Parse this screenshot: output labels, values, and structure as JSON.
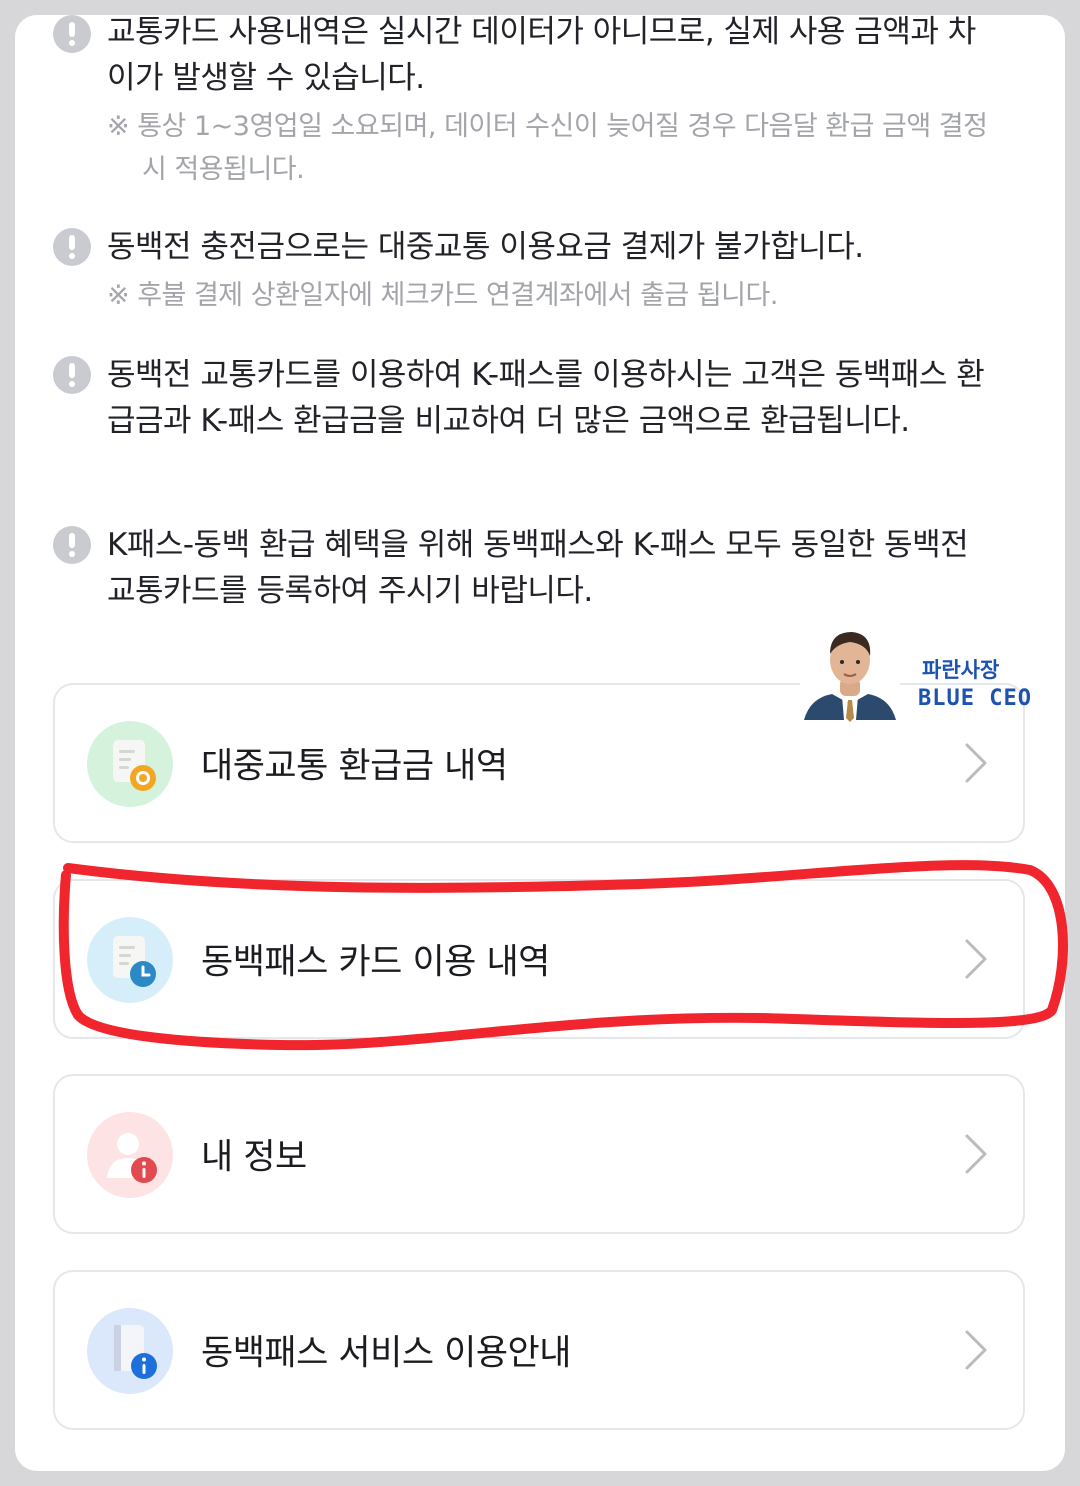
{
  "notices": [
    {
      "text": "교통카드 사용내역은 실시간 데이터가 아니므로, 실제 사용 금액과 차이가 발생할 수 있습니다.",
      "sub": "※ 통상 1~3영업일 소요되며, 데이터 수신이 늦어질 경우 다음달 환급 금액 결정 시 적용됩니다.",
      "icon": "exclamation-icon"
    },
    {
      "text": "동백전 충전금으로는 대중교통 이용요금 결제가 불가합니다.",
      "sub": "※ 후불 결제 상환일자에 체크카드 연결계좌에서 출금 됩니다.",
      "icon": "exclamation-icon"
    },
    {
      "text": "동백전 교통카드를 이용하여 K-패스를 이용하시는 고객은 동백패스 환급금과 K-패스 환급금을 비교하여 더 많은 금액으로 환급됩니다.",
      "icon": "exclamation-icon"
    },
    {
      "text": "K패스-동백 환급 혜택을 위해 동백패스와 K-패스 모두 동일한 동백전 교통카드를 등록하여 주시기 바랍니다.",
      "icon": "exclamation-icon"
    }
  ],
  "menu": [
    {
      "label": "대중교통 환급금 내역",
      "icon": "refund-document-icon",
      "icon_color": "#d5f3dc"
    },
    {
      "label": "동백패스 카드 이용 내역",
      "icon": "usage-history-icon",
      "icon_color": "#d6eefa"
    },
    {
      "label": "내 정보",
      "icon": "user-info-icon",
      "icon_color": "#fde3e4"
    },
    {
      "label": "동백패스 서비스 이용안내",
      "icon": "service-guide-icon",
      "icon_color": "#dbe7fb"
    }
  ],
  "watermark": {
    "title": "파란사장",
    "subtitle": "BLUE CEO"
  },
  "colors": {
    "highlight": "#f0252d",
    "accent_blue": "#1c52b0"
  }
}
